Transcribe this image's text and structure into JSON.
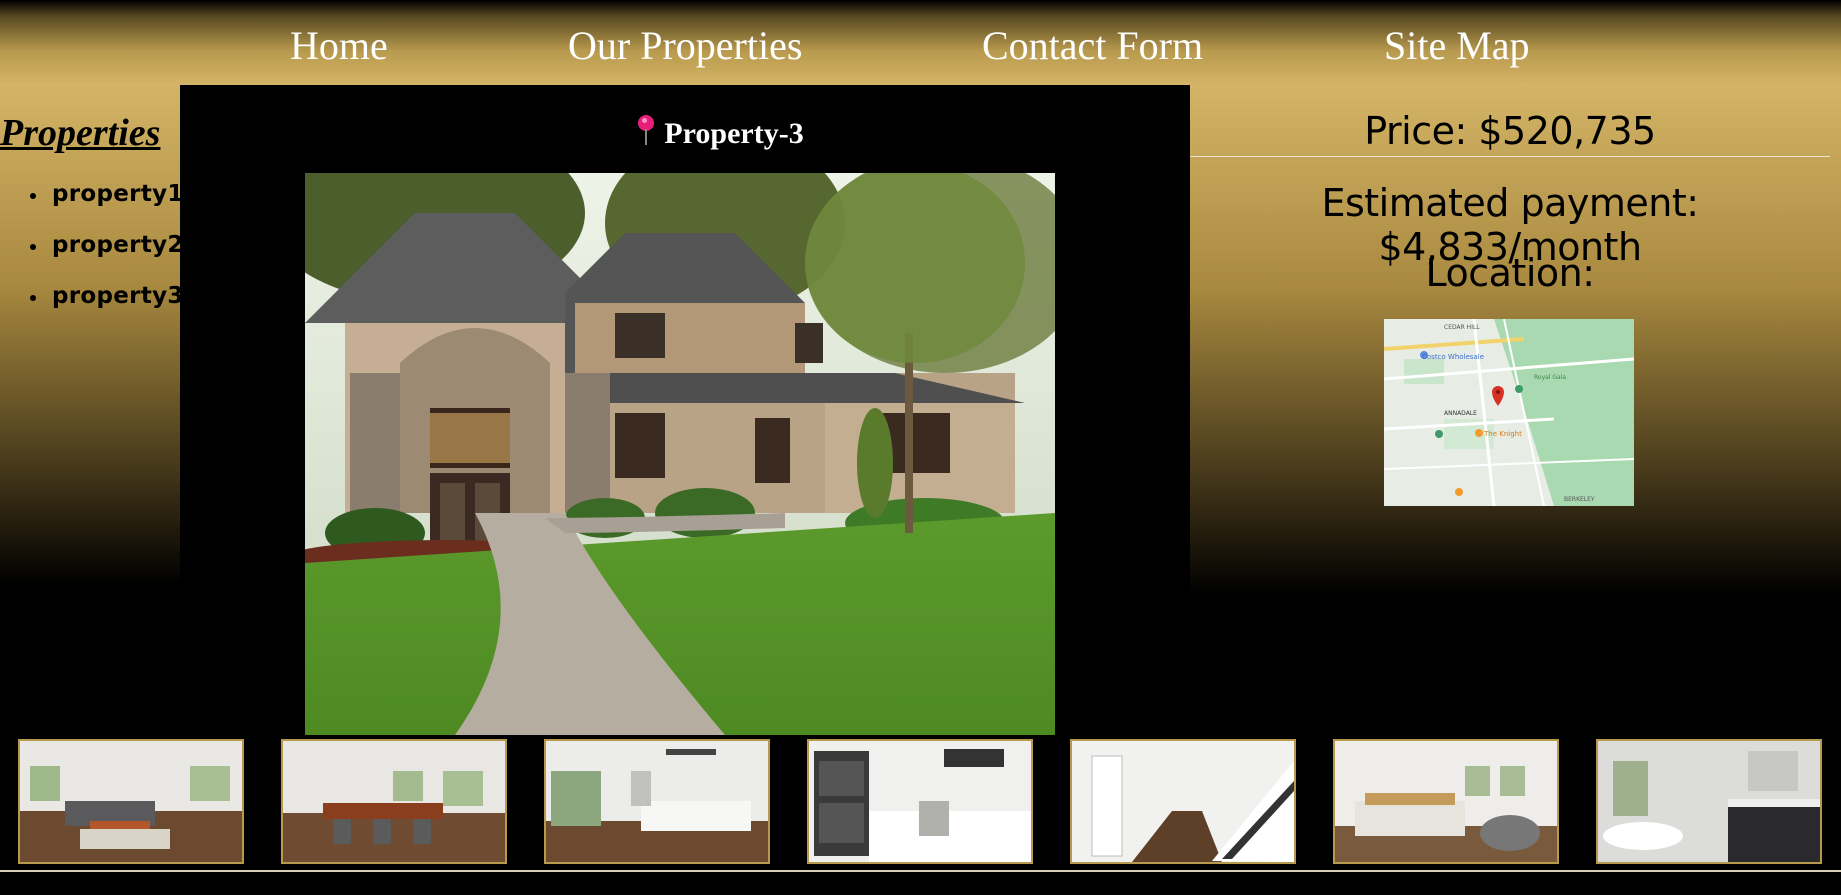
{
  "nav": {
    "items": [
      {
        "label": "Home"
      },
      {
        "label": "Our Properties"
      },
      {
        "label": "Contact Form"
      },
      {
        "label": "Site Map"
      }
    ]
  },
  "sidebar": {
    "title": "Properties",
    "items": [
      {
        "label": "property1"
      },
      {
        "label": "property2"
      },
      {
        "label": "property3"
      }
    ]
  },
  "property": {
    "title": "Property-3",
    "icon": "pushpin-icon"
  },
  "details": {
    "price": "Price: $520,735",
    "payment": "Estimated payment: $4,833/month",
    "location_label": "Location:"
  },
  "map": {
    "labels": [
      "CEDAR HILL",
      "Costco Wholesale",
      "ANNADALE",
      "The Knight",
      "Royal Gala",
      "BERKELEY"
    ]
  },
  "thumbnails": [
    {
      "name": "living-room"
    },
    {
      "name": "dining-room"
    },
    {
      "name": "kitchen"
    },
    {
      "name": "kitchen-ovens"
    },
    {
      "name": "hallway-stairs"
    },
    {
      "name": "bedroom"
    },
    {
      "name": "bathroom"
    }
  ],
  "colors": {
    "gold": "#d4b466",
    "dark_gold": "#a8893f",
    "background": "#000000",
    "pin": "#e61e7a"
  }
}
